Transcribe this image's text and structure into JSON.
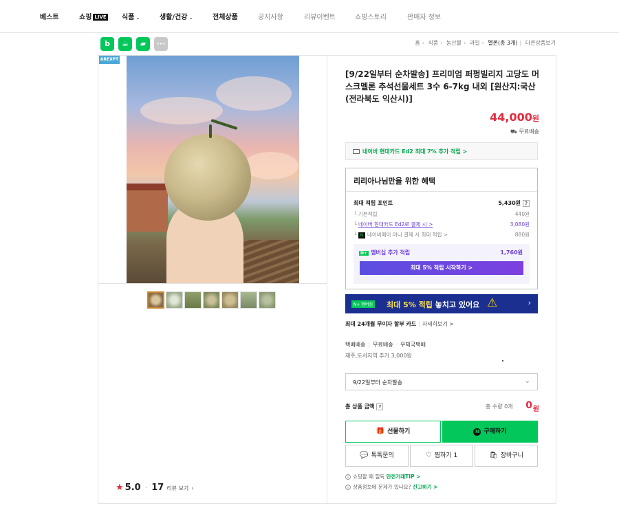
{
  "nav": {
    "items": [
      {
        "label": "베스트"
      },
      {
        "label": "쇼핑",
        "badge": "LIVE"
      },
      {
        "label": "식품"
      },
      {
        "label": "생활/건강"
      },
      {
        "label": "전체상품"
      },
      {
        "label": "공지사항"
      },
      {
        "label": "리뷰이벤트"
      },
      {
        "label": "쇼핑스토리"
      },
      {
        "label": "판매자 정보"
      }
    ]
  },
  "share": {
    "b": "b",
    "more": "···"
  },
  "breadcrumb": {
    "home": "홈",
    "c1": "식품",
    "c2": "농산물",
    "c3": "과일",
    "c4": "멜론(총 3개)",
    "c5": "다른상품보기"
  },
  "gallery": {
    "badge": "AREXPT",
    "thumb_count": 7
  },
  "rating": {
    "score": "5.0",
    "count": "17",
    "label": "리뷰 보기"
  },
  "product": {
    "title": "[9/22일부터 순차발송] 프리미엄 퍼펑빌리지 고당도 머스크멜론 추석선물세트 3수 6-7kg 내외 [원산지:국산(전라북도 익산시)]",
    "price": "44,000",
    "won": "원",
    "shipping": "무료배송"
  },
  "card_banner": "네이버 현대카드 Ed2 최대 7% 추가 적립 >",
  "benefit": {
    "title": "리리아나님만을 위한 혜택",
    "max_label": "최대 적립 포인트",
    "max_value": "5,430원",
    "rows": [
      {
        "label": "기본적립",
        "value": "440원"
      },
      {
        "label": "네이버 현대카드 Ed2로 결제 시 >",
        "value": "3,080원"
      },
      {
        "label": "네이버페이 머니 결제 시 최대 적립 >",
        "value": "880원"
      }
    ],
    "membership_label": "멤버십 추가 적립",
    "membership_value": "1,760원",
    "membership_button": "최대 5% 적립 시작하기 >"
  },
  "promo": {
    "tag": "N+ 멤버십",
    "text_hl": "최대 5% 적립",
    "text_rest": " 놓치고 있어요",
    "chev": "›"
  },
  "installment": {
    "text": "최대 24개월 무이자 할부 카드",
    "more": "자세히보기 >"
  },
  "shipinfo": {
    "a": "택배배송",
    "b": "무료배송",
    "c": "우체국택배",
    "extra": "제주,도서지역 추가 3,000원"
  },
  "option": {
    "selected": "9/22일부터 순차발송"
  },
  "total": {
    "label": "총 상품 금액",
    "qty": "총 수량 0개",
    "price": "0",
    "won": "원"
  },
  "buttons": {
    "gift": "선물하기",
    "buy": "구매하기",
    "talk": "톡톡문의",
    "wish": "찜하기",
    "wish_count": "1",
    "cart": "장바구니"
  },
  "notices": [
    {
      "text": "쇼핑할 때 필독 ",
      "link": "안전거래TIP >"
    },
    {
      "text": "상품정보에 문제가 있나요? ",
      "link": "신고하기 >"
    }
  ],
  "colors": {
    "accent": "#03c75a",
    "price": "#e32c3f",
    "promo_bg": "#1a2f8f",
    "membership": "#6b3fd6"
  }
}
